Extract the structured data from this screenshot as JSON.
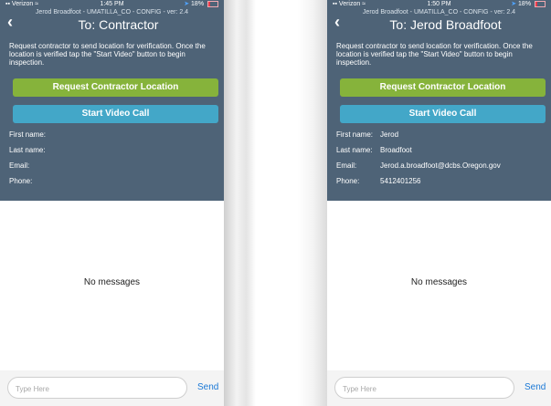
{
  "phones": [
    {
      "status": {
        "carrier": "Verizon",
        "time": "1:45 PM",
        "battery": "18%"
      },
      "subtitle": "Jerod Broadfoot - UMATILLA_CO - CONFIG - ver: 2.4",
      "title": "To: Contractor",
      "instructions": "Request contractor to send location for verification. Once the location is verified tap the \"Start Video\" button to begin inspection.",
      "request_label": "Request Contractor Location",
      "video_label": "Start Video Call",
      "fields": {
        "first_label": "First name:",
        "first_value": "",
        "last_label": "Last name:",
        "last_value": "",
        "email_label": "Email:",
        "email_value": "",
        "phone_label": "Phone:",
        "phone_value": ""
      },
      "empty_text": "No messages",
      "input_placeholder": "Type Here",
      "send_label": "Send"
    },
    {
      "status": {
        "carrier": "Verizon",
        "time": "1:50 PM",
        "battery": "18%"
      },
      "subtitle": "Jerod Broadfoot - UMATILLA_CO - CONFIG - ver: 2.4",
      "title": "To: Jerod Broadfoot",
      "instructions": "Request contractor to send location for verification. Once the location is verified tap the \"Start Video\" button to begin inspection.",
      "request_label": "Request Contractor Location",
      "video_label": "Start Video Call",
      "fields": {
        "first_label": "First name:",
        "first_value": "Jerod",
        "last_label": "Last name:",
        "last_value": "Broadfoot",
        "email_label": "Email:",
        "email_value": "Jerod.a.broadfoot@dcbs.Oregon.gov",
        "phone_label": "Phone:",
        "phone_value": "5412401256"
      },
      "empty_text": "No messages",
      "input_placeholder": "Type Here",
      "send_label": "Send"
    }
  ],
  "colors": {
    "header_bg": "#4e6377",
    "request_button": "#86b33b",
    "video_button": "#43a7c8",
    "send_link": "#1a78d6"
  },
  "icons": {
    "back": "chevron-left-icon",
    "signal": "signal-icon",
    "wifi": "wifi-icon",
    "location": "location-arrow-icon",
    "battery": "battery-icon"
  }
}
